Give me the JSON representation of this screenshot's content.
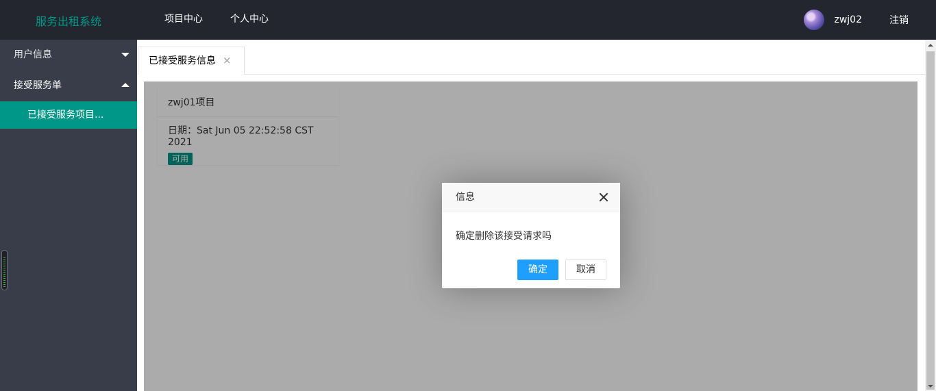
{
  "header": {
    "logo": "服务出租系统",
    "nav": [
      "项目中心",
      "个人中心"
    ],
    "username": "zwj02",
    "logout": "注销"
  },
  "sidebar": {
    "groups": [
      {
        "label": "用户信息",
        "state": "collapsed"
      },
      {
        "label": "接受服务单",
        "state": "expanded",
        "children": [
          "已接受服务项目..."
        ]
      }
    ]
  },
  "tabs": [
    {
      "label": "已接受服务信息",
      "close": "×"
    }
  ],
  "card": {
    "title": "zwj01项目",
    "date": "日期：Sat Jun 05 22:52:58 CST 2021",
    "badge": "可用"
  },
  "dialog": {
    "title": "信息",
    "message": "确定删除该接受请求吗",
    "confirm": "确定",
    "cancel": "取消"
  },
  "colors": {
    "header_bg": "#23262e",
    "sidebar_bg": "#393d49",
    "accent": "#009688",
    "primary_button": "#1e9fff"
  }
}
